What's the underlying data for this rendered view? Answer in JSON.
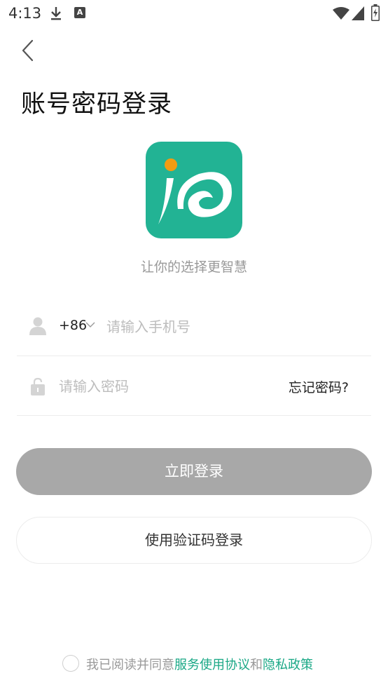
{
  "status_bar": {
    "time": "4:13",
    "icons": [
      "download-icon",
      "accessibility-icon",
      "wifi-icon",
      "signal-icon",
      "battery-icon"
    ],
    "a11y_glyph": "A"
  },
  "header": {
    "back_icon": "chevron-left-icon",
    "title": "账号密码登录"
  },
  "logo": {
    "icon": "app-logo",
    "brand_color": "#22b394",
    "dot_color": "#f39c12"
  },
  "slogan": "让你的选择更智慧",
  "form": {
    "country_code": "+86",
    "phone_placeholder": "请输入手机号",
    "phone_value": "",
    "password_placeholder": "请输入密码",
    "password_value": "",
    "forgot_label": "忘记密码?"
  },
  "buttons": {
    "login_label": "立即登录",
    "sms_login_label": "使用验证码登录"
  },
  "agreement": {
    "checked": false,
    "prefix": "我已阅读并同意",
    "terms_link": "服务使用协议",
    "joiner": "和",
    "privacy_link": "隐私政策",
    "link_color": "#1aa886"
  }
}
